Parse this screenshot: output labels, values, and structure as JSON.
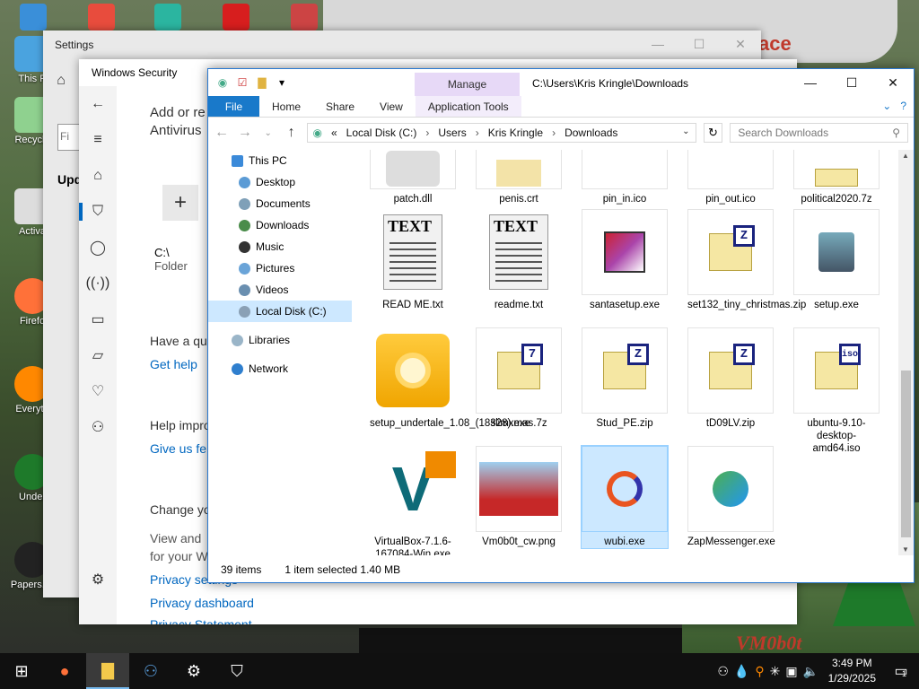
{
  "settings": {
    "title": "Settings",
    "find_placeholder": "Fi",
    "section": "Upd",
    "controls": [
      "—",
      "☐",
      "✕"
    ]
  },
  "winsec": {
    "title": "Windows Security",
    "heading1": "Add or re",
    "heading2": "Antivirus",
    "folder_name": "C:\\",
    "folder_type": "Folder",
    "have_q": "Have a qu",
    "get_help": "Get help",
    "help_improve": "Help impro",
    "give_feedback": "Give us fe",
    "change": "Change yo",
    "view_and": "View and",
    "for_your": "for your W",
    "privacy_settings": "Privacy settings",
    "privacy_dashboard": "Privacy dashboard",
    "privacy_statement": "Privacy Statement"
  },
  "explorer": {
    "manage": "Manage",
    "path_title": "C:\\Users\\Kris Kringle\\Downloads",
    "controls": [
      "—",
      "☐",
      "✕"
    ],
    "tabs": {
      "file": "File",
      "home": "Home",
      "share": "Share",
      "view": "View",
      "tools": "Application Tools"
    },
    "breadcrumb": [
      "«",
      "Local Disk (C:)",
      "Users",
      "Kris Kringle",
      "Downloads"
    ],
    "search_placeholder": "Search Downloads",
    "nav": [
      {
        "label": "This PC",
        "level": 1,
        "color": "#3b8ad9"
      },
      {
        "label": "Desktop",
        "level": 2,
        "color": "#5b9bd5"
      },
      {
        "label": "Documents",
        "level": 2,
        "color": "#7fa0b8"
      },
      {
        "label": "Downloads",
        "level": 2,
        "color": "#4a8c4a"
      },
      {
        "label": "Music",
        "level": 2,
        "color": "#333333"
      },
      {
        "label": "Pictures",
        "level": 2,
        "color": "#6aa4d8"
      },
      {
        "label": "Videos",
        "level": 2,
        "color": "#6a8fb0"
      },
      {
        "label": "Local Disk (C:)",
        "level": 2,
        "color": "#8aa0b5"
      },
      {
        "label": "Libraries",
        "level": 1,
        "color": "#9ab5c8"
      },
      {
        "label": "Network",
        "level": 1,
        "color": "#2f7fce"
      }
    ],
    "files_row0": [
      "patch.dll",
      "penis.crt",
      "pin_in.ico",
      "pin_out.ico",
      "political2020.7z"
    ],
    "files": [
      {
        "name": "READ ME.txt",
        "kind": "text"
      },
      {
        "name": "readme.txt",
        "kind": "text"
      },
      {
        "name": "santasetup.exe",
        "kind": "santa"
      },
      {
        "name": "set132_tiny_christmas.zip",
        "kind": "zip",
        "badge": "Z"
      },
      {
        "name": "setup.exe",
        "kind": "setup"
      },
      {
        "name": "setup_undertale_1.08_(18328).exe",
        "kind": "disc"
      },
      {
        "name": "slimxmas.7z",
        "kind": "zip",
        "badge": "7"
      },
      {
        "name": "Stud_PE.zip",
        "kind": "zip",
        "badge": "Z"
      },
      {
        "name": "tD09LV.zip",
        "kind": "zip",
        "badge": "Z"
      },
      {
        "name": "ubuntu-9.10-desktop-amd64.iso",
        "kind": "zip",
        "badge": "iso"
      },
      {
        "name": "VirtualBox-7.1.6-167084-Win.exe",
        "kind": "vbox"
      },
      {
        "name": "Vm0b0t_cw.png",
        "kind": "png"
      },
      {
        "name": "wubi.exe",
        "kind": "wubi",
        "selected": true
      },
      {
        "name": "ZapMessenger.exe",
        "kind": "msn"
      }
    ],
    "status": {
      "count": "39 items",
      "selected": "1 item selected  1.40 MB"
    }
  },
  "desktop": {
    "icons": [
      "This P",
      "Recycle",
      "Activa",
      "Firefo",
      "Everyth",
      "Under",
      "Papers, P"
    ]
  },
  "taskbar": {
    "time": "3:49 PM",
    "date": "1/29/2025",
    "notifications": "1"
  },
  "colors": {
    "accent": "#1979ca",
    "manage_bg": "#e7d9f7",
    "selection": "#cce8ff"
  }
}
